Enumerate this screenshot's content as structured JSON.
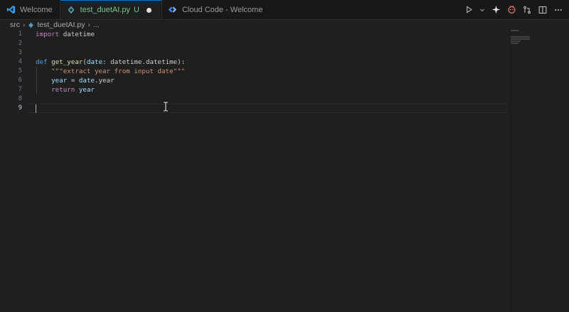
{
  "tabs": [
    {
      "label": "Welcome",
      "icon": "vscode-logo-icon"
    },
    {
      "label": "test_duetAI.py",
      "icon": "python-icon",
      "status": "U",
      "active": true,
      "dirty": true
    },
    {
      "label": "Cloud Code - Welcome",
      "icon": "cloud-code-icon"
    }
  ],
  "toolbar": {
    "icons": [
      "run-icon",
      "chevron-down-icon",
      "sparkle-icon",
      "copilot-icon",
      "diff-icon",
      "split-editor-icon",
      "more-icon"
    ]
  },
  "breadcrumb": {
    "folder": "src",
    "file": "test_duetAI.py",
    "ellipsis": "..."
  },
  "editor": {
    "line_numbers": [
      "1",
      "2",
      "3",
      "4",
      "5",
      "6",
      "7",
      "8",
      "9"
    ],
    "current_line": 9,
    "lines": [
      [
        {
          "t": "import",
          "c": "kw"
        },
        {
          "t": " datetime",
          "c": "plain"
        }
      ],
      [],
      [],
      [
        {
          "t": "def",
          "c": "def"
        },
        {
          "t": " ",
          "c": "plain"
        },
        {
          "t": "get_year",
          "c": "fn"
        },
        {
          "t": "(",
          "c": "plain"
        },
        {
          "t": "date",
          "c": "param"
        },
        {
          "t": ": datetime.datetime):",
          "c": "plain"
        }
      ],
      [
        {
          "t": "    ",
          "c": "plain"
        },
        {
          "t": "\"\"\"extract year from input date\"\"\"",
          "c": "str"
        }
      ],
      [
        {
          "t": "    ",
          "c": "plain"
        },
        {
          "t": "year",
          "c": "var"
        },
        {
          "t": " = ",
          "c": "plain"
        },
        {
          "t": "date",
          "c": "var"
        },
        {
          "t": ".year",
          "c": "plain"
        }
      ],
      [
        {
          "t": "    ",
          "c": "plain"
        },
        {
          "t": "return",
          "c": "kw"
        },
        {
          "t": " ",
          "c": "plain"
        },
        {
          "t": "year",
          "c": "var"
        }
      ],
      [],
      []
    ]
  },
  "colors": {
    "accent": "#0078d4",
    "untracked": "#73c991",
    "background": "#1f1f1f"
  }
}
